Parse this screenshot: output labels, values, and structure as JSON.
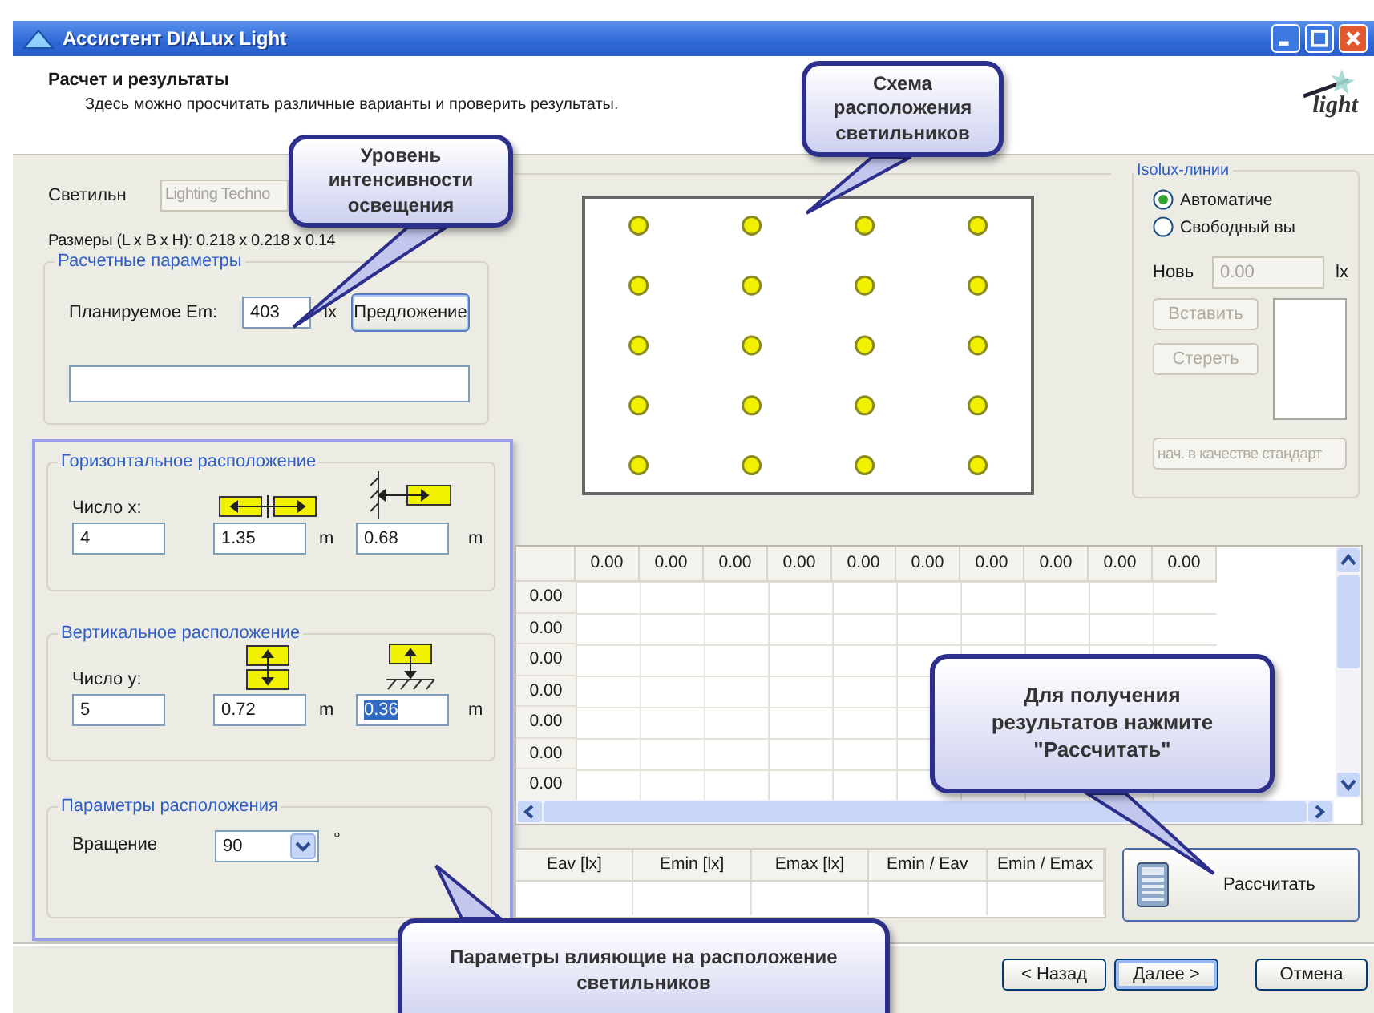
{
  "window": {
    "title": "Ассистент DIALux Light"
  },
  "header": {
    "title": "Расчет и результаты",
    "subtitle": "Здесь можно просчитать различные варианты и проверить результаты.",
    "logo_text": "light"
  },
  "luminaire": {
    "label": "Светильн",
    "value": "Lighting Techno",
    "disabled": true
  },
  "dimensions": "Размеры (L x B x H): 0.218 x 0.218 x 0.14",
  "calculation_parameters": {
    "title": "Расчетные параметры",
    "label": "Планируемое Em:",
    "value": "403",
    "unit": "lx",
    "button": "Предложение"
  },
  "horizontal": {
    "title": "Горизонтальное расположение",
    "count_label": "Число x:",
    "count": "4",
    "spacing": "1.35",
    "spacing_unit": "m",
    "edge": "0.68",
    "edge_unit": "m"
  },
  "vertical": {
    "title": "Вертикальное расположение",
    "count_label": "Число y:",
    "count": "5",
    "spacing": "0.72",
    "spacing_unit": "m",
    "edge": "0.36",
    "edge_unit": "m",
    "edge_selected": true
  },
  "placement": {
    "title": "Параметры расположения",
    "rotation_label": "Вращение",
    "rotation": "90",
    "unit": "°"
  },
  "isolux": {
    "title": "Isolux-линии",
    "options": [
      {
        "label": "Автоматиче",
        "selected": true
      },
      {
        "label": "Свободный вы",
        "selected": false
      }
    ],
    "value_label": "Новь",
    "value": "0.00",
    "unit": "lx",
    "value_disabled": true,
    "buttons": [
      {
        "label": "Вставить",
        "disabled": true
      },
      {
        "label": "Стереть",
        "disabled": true
      },
      {
        "label": "нач. в качестве стандарт",
        "disabled": true
      }
    ]
  },
  "grid": {
    "column_headers": [
      "0.00",
      "0.00",
      "0.00",
      "0.00",
      "0.00",
      "0.00",
      "0.00",
      "0.00",
      "0.00",
      "0.00"
    ],
    "row_headers": [
      "0.00",
      "0.00",
      "0.00",
      "0.00",
      "0.00",
      "0.00",
      "0.00"
    ]
  },
  "results": {
    "columns": [
      "Eav [lx]",
      "Emin [lx]",
      "Emax [lx]",
      "Emin / Eav",
      "Emin / Emax"
    ]
  },
  "calculate_button": "Рассчитать",
  "nav": [
    {
      "label": "< Назад",
      "default": false
    },
    {
      "label": "Далее >",
      "default": true
    },
    {
      "label": "Отмена",
      "default": false
    }
  ],
  "callouts": [
    {
      "text": "Уровень интенсивности освещения"
    },
    {
      "text": "Схема расположения светильников"
    },
    {
      "text": "Для получения результатов нажмите \"Рассчитать\""
    },
    {
      "text": "Параметры влияющие на расположение светильников"
    }
  ]
}
